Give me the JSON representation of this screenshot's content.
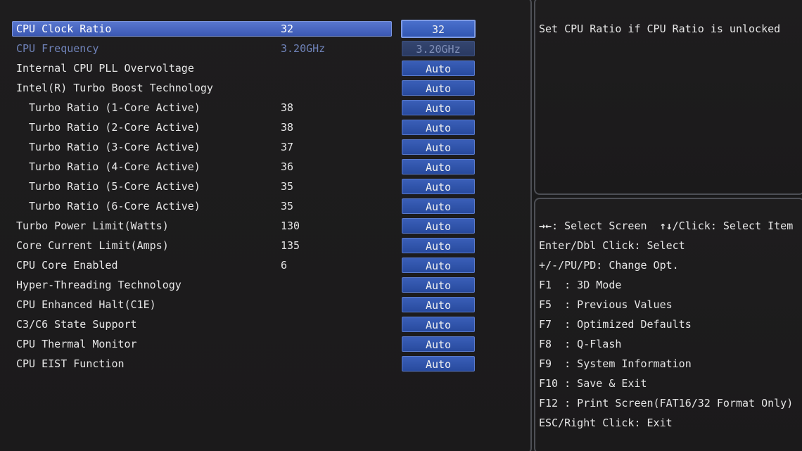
{
  "settings": [
    {
      "label": "CPU Clock Ratio",
      "value": "32",
      "option": "32",
      "state": "selected",
      "indent": false
    },
    {
      "label": "CPU Frequency",
      "value": "3.20GHz",
      "option": "3.20GHz",
      "state": "disabled",
      "indent": false
    },
    {
      "label": "Internal CPU PLL Overvoltage",
      "value": "",
      "option": "Auto",
      "state": "normal",
      "indent": false
    },
    {
      "label": "Intel(R) Turbo Boost Technology",
      "value": "",
      "option": "Auto",
      "state": "normal",
      "indent": false
    },
    {
      "label": "Turbo Ratio (1-Core Active)",
      "value": "38",
      "option": "Auto",
      "state": "normal",
      "indent": true
    },
    {
      "label": "Turbo Ratio (2-Core Active)",
      "value": "38",
      "option": "Auto",
      "state": "normal",
      "indent": true
    },
    {
      "label": "Turbo Ratio (3-Core Active)",
      "value": "37",
      "option": "Auto",
      "state": "normal",
      "indent": true
    },
    {
      "label": "Turbo Ratio (4-Core Active)",
      "value": "36",
      "option": "Auto",
      "state": "normal",
      "indent": true
    },
    {
      "label": "Turbo Ratio (5-Core Active)",
      "value": "35",
      "option": "Auto",
      "state": "normal",
      "indent": true
    },
    {
      "label": "Turbo Ratio (6-Core Active)",
      "value": "35",
      "option": "Auto",
      "state": "normal",
      "indent": true
    },
    {
      "label": "Turbo Power Limit(Watts)",
      "value": "130",
      "option": "Auto",
      "state": "normal",
      "indent": false
    },
    {
      "label": "Core Current Limit(Amps)",
      "value": "135",
      "option": "Auto",
      "state": "normal",
      "indent": false
    },
    {
      "label": "CPU Core Enabled",
      "value": "6",
      "option": "Auto",
      "state": "normal",
      "indent": false
    },
    {
      "label": "Hyper-Threading Technology",
      "value": "",
      "option": "Auto",
      "state": "normal",
      "indent": false
    },
    {
      "label": "CPU Enhanced Halt(C1E)",
      "value": "",
      "option": "Auto",
      "state": "normal",
      "indent": false
    },
    {
      "label": "C3/C6 State Support",
      "value": "",
      "option": "Auto",
      "state": "normal",
      "indent": false
    },
    {
      "label": "CPU Thermal Monitor",
      "value": "",
      "option": "Auto",
      "state": "normal",
      "indent": false
    },
    {
      "label": "CPU EIST Function",
      "value": "",
      "option": "Auto",
      "state": "normal",
      "indent": false
    }
  ],
  "help": {
    "text": "Set CPU Ratio if CPU Ratio is unlocked"
  },
  "keys": [
    {
      "icon": "left-right-arrows",
      "glyph": "→←",
      "text": ": Select Screen  ",
      "icon2": "up-down-arrows",
      "glyph2": "↑↓",
      "text2": "/Click: Select Item"
    },
    {
      "text": "Enter/Dbl Click: Select"
    },
    {
      "text": "+/-/PU/PD: Change Opt."
    },
    {
      "text": "F1  : 3D Mode"
    },
    {
      "text": "F5  : Previous Values"
    },
    {
      "text": "F7  : Optimized Defaults"
    },
    {
      "text": "F8  : Q-Flash"
    },
    {
      "text": "F9  : System Information"
    },
    {
      "text": "F10 : Save & Exit"
    },
    {
      "text": "F12 : Print Screen(FAT16/32 Format Only)"
    },
    {
      "text": "ESC/Right Click: Exit"
    }
  ],
  "colors": {
    "background": "#1a1a1b",
    "selected_row": "#4a68c4",
    "option_button": "#2f54aa",
    "disabled_text": "#6f82b8"
  }
}
